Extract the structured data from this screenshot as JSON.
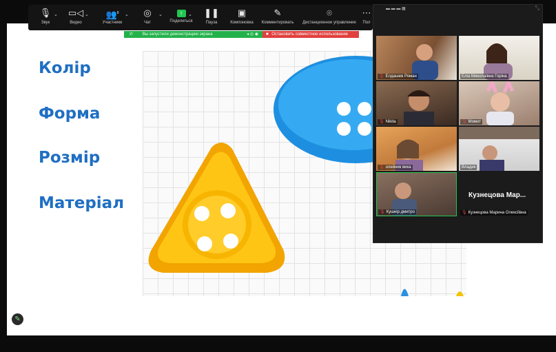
{
  "toolbar": {
    "audio": {
      "label": "Звук",
      "icon": "microphone-icon"
    },
    "video": {
      "label": "Видео",
      "icon": "camera-icon"
    },
    "participants": {
      "label": "Участники",
      "count": "8",
      "icon": "participants-icon"
    },
    "chat": {
      "label": "Чат",
      "icon": "chat-icon"
    },
    "share": {
      "label": "Поделиться",
      "icon": "share-screen-icon"
    },
    "pause": {
      "label": "Пауза",
      "icon": "pause-icon"
    },
    "layout": {
      "label": "Компоновка",
      "icon": "layout-icon"
    },
    "annotate": {
      "label": "Комментировать",
      "icon": "pencil-icon"
    },
    "remote": {
      "label": "Дистанционное управление",
      "icon": "mouse-icon"
    },
    "more": {
      "label": "Пол"
    }
  },
  "share_banner": {
    "text": "Вы запустили демонстрацию экрана",
    "stop_text": "Остановить совместное использование",
    "green": "#23b14b",
    "red": "#e0403e"
  },
  "slide": {
    "words": [
      "Колір",
      "Форма",
      "Розмір",
      "Матеріал"
    ],
    "word_color": "#1f6fc2"
  },
  "participants": [
    {
      "name": "Елдашев Роман",
      "muted": true
    },
    {
      "name": "Еліа Миколаївна Горіна",
      "muted": false
    },
    {
      "name": "Nikita",
      "muted": true
    },
    {
      "name": "Момот",
      "muted": true
    },
    {
      "name": "олейник вика",
      "muted": true
    },
    {
      "name": "Владик",
      "muted": false
    },
    {
      "name": "Кушнір дмитро",
      "muted": true,
      "active": true
    },
    {
      "name": "Кузнецова Марина Олексіївна",
      "muted": true,
      "display": "Кузнецова Мар..."
    }
  ]
}
